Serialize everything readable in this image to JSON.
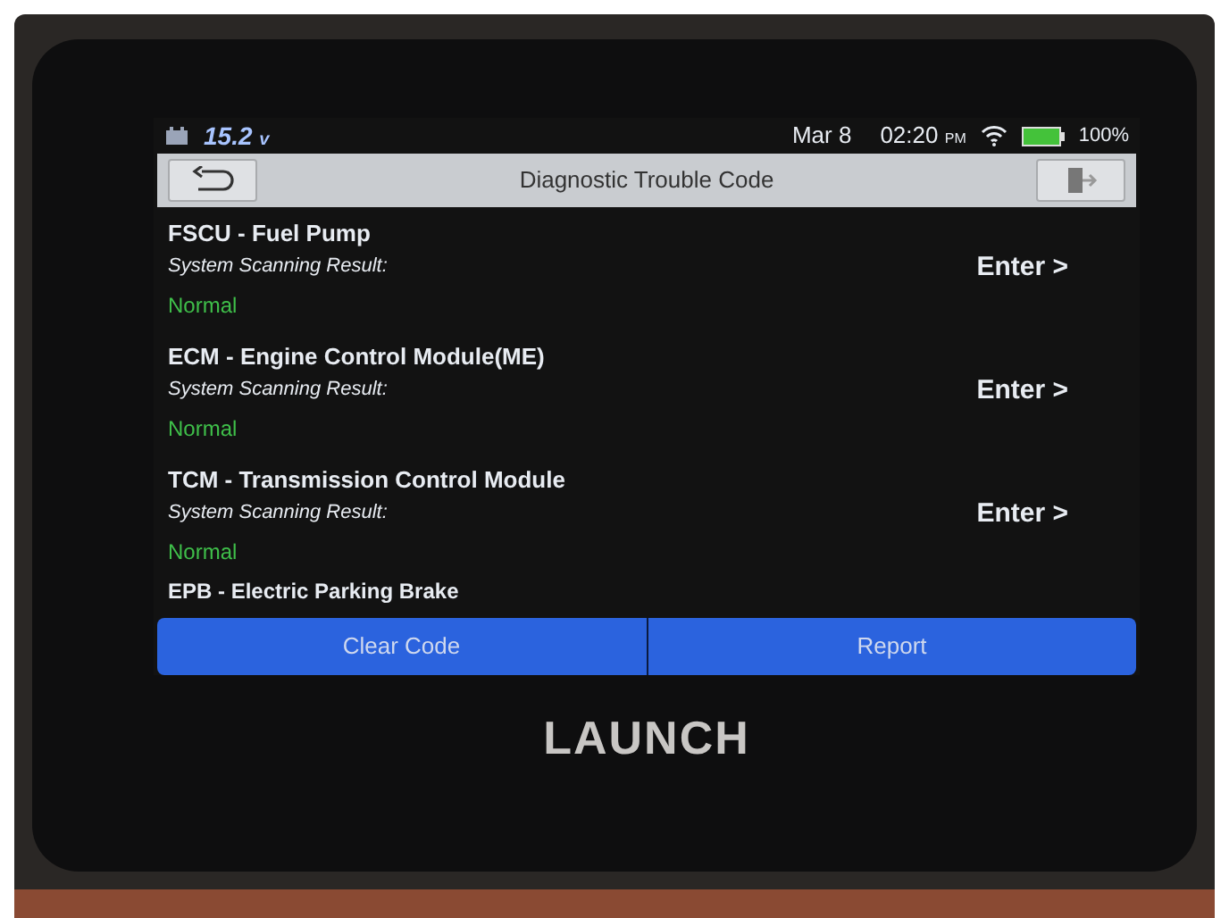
{
  "status_bar": {
    "voltage": "15.2",
    "voltage_unit": "v",
    "date": "Mar 8",
    "time": "02:20",
    "ampm": "PM",
    "battery": "100%"
  },
  "title_bar": {
    "title": "Diagnostic Trouble Code"
  },
  "systems": [
    {
      "name": "FSCU - Fuel Pump",
      "result_label": "System Scanning Result:",
      "status": "Normal",
      "action": "Enter >"
    },
    {
      "name": "ECM - Engine Control Module(ME)",
      "result_label": "System Scanning Result:",
      "status": "Normal",
      "action": "Enter >"
    },
    {
      "name": "TCM - Transmission Control Module",
      "result_label": "System Scanning Result:",
      "status": "Normal",
      "action": "Enter >"
    },
    {
      "name": "EPB - Electric Parking Brake"
    }
  ],
  "buttons": [
    "Clear Code",
    "Report"
  ],
  "brand": "LAUNCH"
}
